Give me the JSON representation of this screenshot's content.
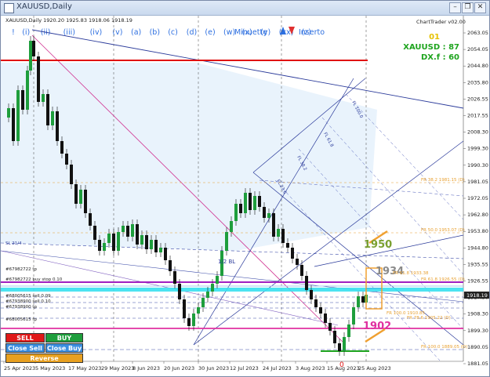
{
  "window": {
    "title": "XAUUSD,Daily",
    "controls": [
      "minimize",
      "restore",
      "close"
    ]
  },
  "header": {
    "symbol_info": "XAUUSD,Daily  1920.20 1925.83 1918.06 1918.19",
    "brand": "ChartTrader v02.00"
  },
  "wave_toolbar": {
    "labels": [
      "!",
      "(i)",
      "(ii)",
      "(iii)",
      "(iv)",
      "(v)",
      "(a)",
      "(b)",
      "(c)",
      "(d)",
      "(e)",
      "(w)",
      "(x)",
      "(y)",
      "(xx)",
      "(z)",
      "o"
    ],
    "mode": "Minuette",
    "insert": "Insert"
  },
  "info_panel": {
    "line1": "01",
    "line2": "XAUUSD : 87",
    "line3": "DX.f : 60"
  },
  "price_axis": {
    "ticks": [
      "2063.05",
      "2054.05",
      "2044.80",
      "2035.80",
      "2026.55",
      "2017.55",
      "2008.30",
      "1999.30",
      "1990.30",
      "1981.05",
      "1972.05",
      "1962.80",
      "1953.80",
      "1944.80",
      "1935.55",
      "1926.55",
      "1917.30",
      "1908.30",
      "1899.30",
      "1890.05",
      "1881.05"
    ],
    "current_price": "1918.19"
  },
  "date_axis": {
    "ticks": [
      "25 Apr 2023",
      "5 May 2023",
      "17 May 2023",
      "29 May 2023",
      "8 Jun 2023",
      "20 Jun 2023",
      "30 Jun 2023",
      "12 Jul 2023",
      "24 Jul 2023",
      "3 Aug 2023",
      "15 Aug 2023",
      "25 Aug 2023"
    ]
  },
  "annotations": {
    "level_1950": "1950",
    "level_1934": "1934",
    "level_1902": "1902",
    "wave_zero": "0",
    "wave_12": "1/2 BL",
    "sl_tag": "SL 21/4"
  },
  "order_lines": [
    {
      "text": "#67982722 tp"
    },
    {
      "text": "#67982722 buy stop 0.10"
    },
    {
      "text": "#68005615 sell 0.09"
    },
    {
      "text": "#67938900 sell 0.10"
    },
    {
      "text": "#67938900 tp"
    },
    {
      "text": "#68005615 tp"
    }
  ],
  "fib_labels": [
    {
      "text": "FR 38.2 1981.15 (D)"
    },
    {
      "text": "FR 50.0 1953.07 (D)"
    },
    {
      "text": "FR 61.8 1933.38"
    },
    {
      "text": "FR 61.8 1926.55 (D)"
    },
    {
      "text": "FR 78.6 1905.22 (D)"
    },
    {
      "text": "FR 100.0 1889.05 (D)"
    },
    {
      "text": "FR 100.0 1910.85"
    }
  ],
  "trade_panel": {
    "sell": "SELL",
    "buy": "BUY",
    "close_sell": "Close Sell",
    "close_buy": "Close Buy",
    "reverse": "Reverse"
  },
  "colors": {
    "bull": "#1e9e3c",
    "bear": "#111111",
    "resistance": "#e01010",
    "cyan_band": "#38e0f0",
    "purple_line": "#a020c0",
    "orange_box": "#f0a030",
    "pink_level": "#e030a0"
  }
}
